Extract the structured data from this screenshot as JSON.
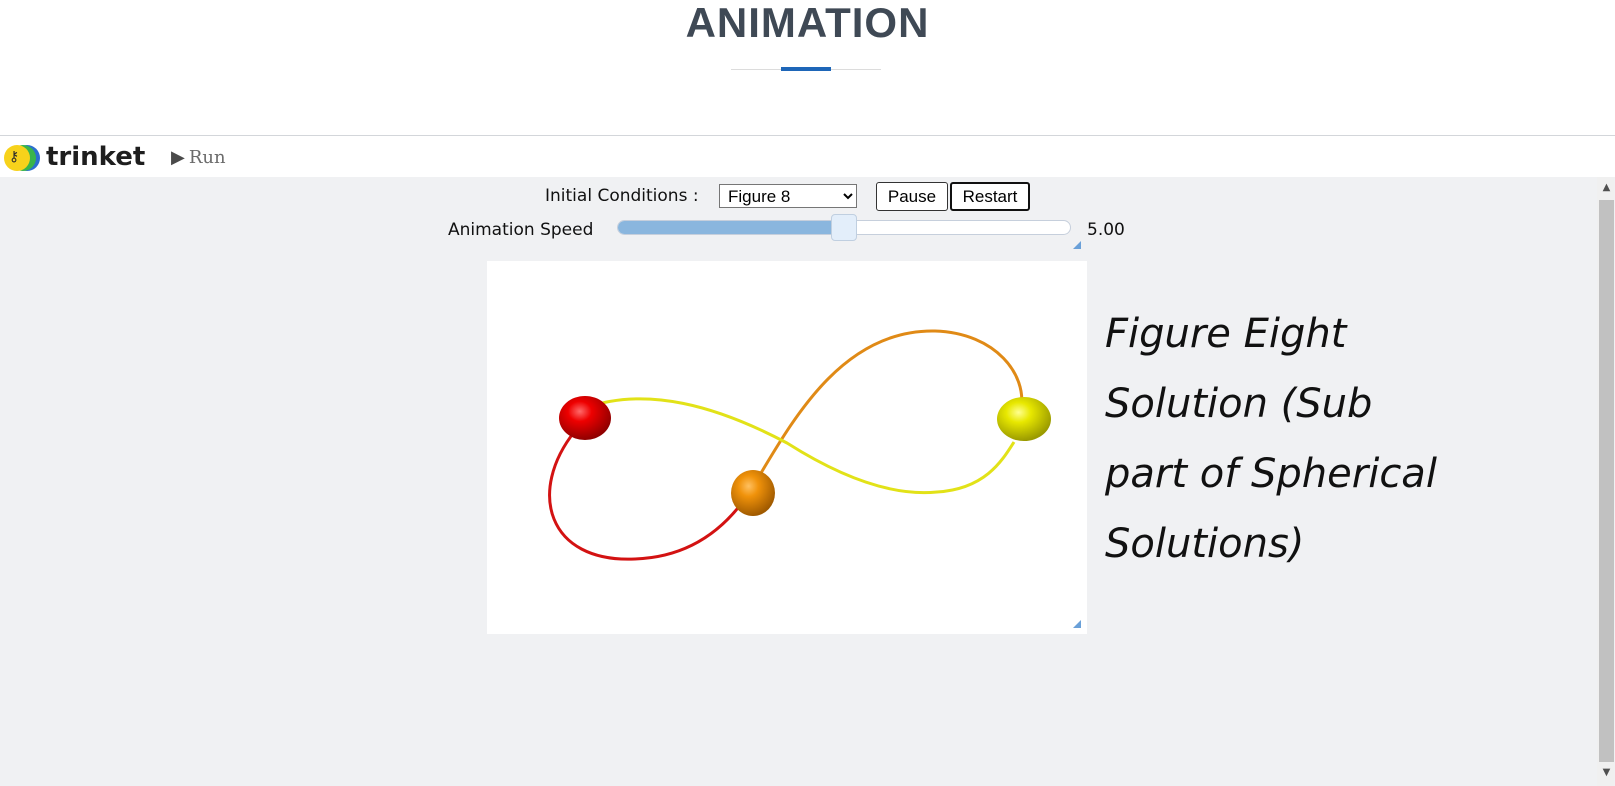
{
  "page": {
    "title": "ANIMATION"
  },
  "toolbar": {
    "logo_text": "trinket",
    "run_label": "Run"
  },
  "controls": {
    "initial_conditions_label": "Initial Conditions :",
    "initial_conditions_selected": "Figure 8",
    "pause_label": "Pause",
    "restart_label": "Restart",
    "speed_label": "Animation Speed",
    "speed_value": "5.00",
    "speed_fraction": 0.5
  },
  "simulation": {
    "caption_lines": [
      "Figure Eight",
      "Solution (Sub",
      "part of Spherical",
      "Solutions)"
    ],
    "bodies": [
      {
        "name": "red-body",
        "color": "#e00000"
      },
      {
        "name": "orange-body",
        "color": "#e88a00"
      },
      {
        "name": "yellow-body",
        "color": "#e5e500"
      }
    ]
  },
  "icons": {
    "play": "play-icon",
    "key": "key-icon",
    "chevron": "chevron-down-icon",
    "resize": "resize-grip-icon"
  }
}
